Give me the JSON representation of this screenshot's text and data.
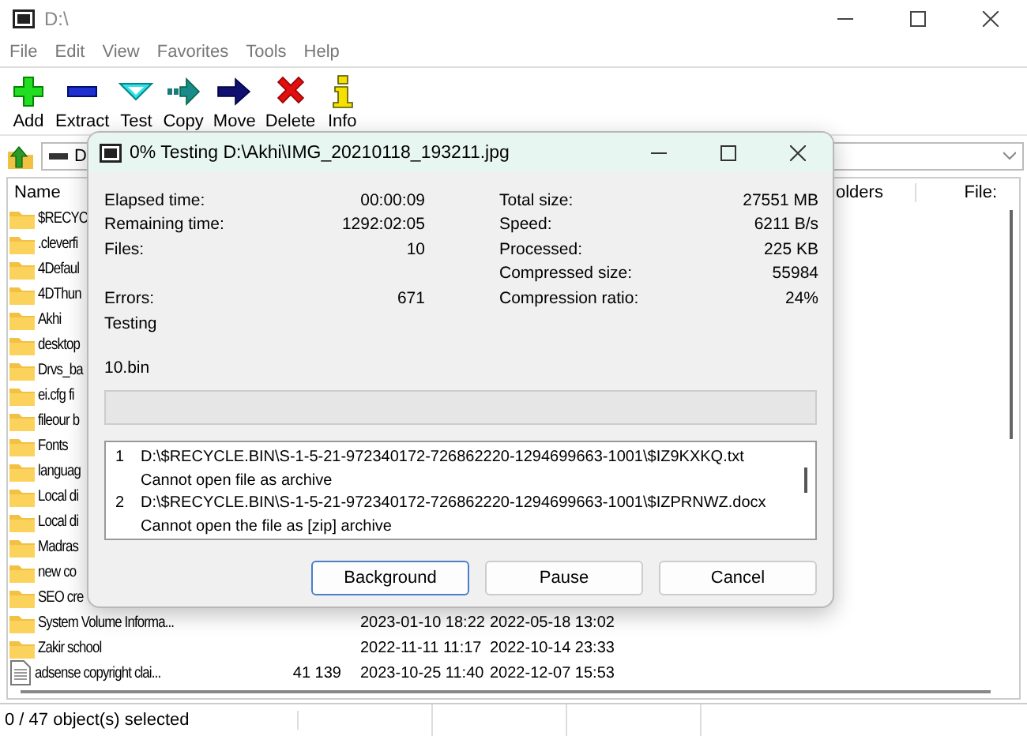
{
  "window": {
    "title": "D:\\"
  },
  "menu": [
    "File",
    "Edit",
    "View",
    "Favorites",
    "Tools",
    "Help"
  ],
  "toolbar": [
    {
      "label": "Add",
      "kind": "add"
    },
    {
      "label": "Extract",
      "kind": "extract"
    },
    {
      "label": "Test",
      "kind": "test"
    },
    {
      "label": "Copy",
      "kind": "copy"
    },
    {
      "label": "Move",
      "kind": "move"
    },
    {
      "label": "Delete",
      "kind": "delete"
    },
    {
      "label": "Info",
      "kind": "info"
    }
  ],
  "address": {
    "value": "D"
  },
  "columns": [
    "Name",
    "olders",
    "File:"
  ],
  "files": [
    {
      "name": "$RECYC",
      "kind": "folder"
    },
    {
      "name": ".cleverfi",
      "kind": "folder"
    },
    {
      "name": "4Defaul",
      "kind": "folder"
    },
    {
      "name": "4DThun",
      "kind": "folder"
    },
    {
      "name": "Akhi",
      "kind": "folder"
    },
    {
      "name": "desktop",
      "kind": "folder"
    },
    {
      "name": "Drvs_ba",
      "kind": "folder"
    },
    {
      "name": "ei.cfg fi",
      "kind": "folder"
    },
    {
      "name": "fileour b",
      "kind": "folder"
    },
    {
      "name": "Fonts",
      "kind": "folder"
    },
    {
      "name": "languag",
      "kind": "folder"
    },
    {
      "name": "Local di",
      "kind": "folder"
    },
    {
      "name": "Local di",
      "kind": "folder"
    },
    {
      "name": "Madras",
      "kind": "folder"
    },
    {
      "name": "new co",
      "kind": "folder"
    },
    {
      "name": "SEO cre",
      "kind": "folder"
    },
    {
      "name": "System Volume Informa...",
      "kind": "folder",
      "modified": "2023-01-10 18:22",
      "created": "2022-05-18 13:02"
    },
    {
      "name": "Zakir school",
      "kind": "folder",
      "modified": "2022-11-11 11:17",
      "created": "2022-10-14 23:33"
    },
    {
      "name": "adsense copyright clai...",
      "kind": "file",
      "size": "41 139",
      "modified": "2023-10-25 11:40",
      "created": "2022-12-07 15:53"
    }
  ],
  "status_bar": [
    "0 / 47 object(s) selected"
  ],
  "dialog": {
    "title": "0% Testing D:\\Akhi\\IMG_20210118_193211.jpg",
    "stats": [
      {
        "left": {
          "label": "Elapsed time:",
          "value": "00:00:09"
        },
        "right": {
          "label": "Total size:",
          "value": "27551 MB"
        }
      },
      {
        "left": {
          "label": "Remaining time:",
          "value": "1292:02:05"
        },
        "right": {
          "label": "Speed:",
          "value": "6211 B/s"
        }
      },
      {
        "left": {
          "label": "Files:",
          "value": "10"
        },
        "right": {
          "label": "Processed:",
          "value": "225 KB"
        }
      },
      {
        "right": {
          "label": "Compressed size:",
          "value": "55984"
        }
      },
      {
        "left": {
          "label": "Errors:",
          "value": "671"
        },
        "right": {
          "label": "Compression ratio:",
          "value": "24%"
        }
      }
    ],
    "status": "Testing",
    "current_file": "10.bin",
    "progress": {
      "level": 0
    },
    "log": [
      {
        "number": "1",
        "path": "D:\\$RECYCLE.BIN\\S-1-5-21-972340172-726862220-1294699663-1001\\$IZ9KXKQ.txt",
        "message": "Cannot open file as archive"
      },
      {
        "number": "2",
        "path": "D:\\$RECYCLE.BIN\\S-1-5-21-972340172-726862220-1294699663-1001\\$IZPRNWZ.docx",
        "message": "Cannot open the file as [zip] archive"
      }
    ],
    "buttons": [
      {
        "label": "Background",
        "focused": true
      },
      {
        "label": "Pause",
        "focused": false
      },
      {
        "label": "Cancel",
        "focused": false
      }
    ]
  }
}
